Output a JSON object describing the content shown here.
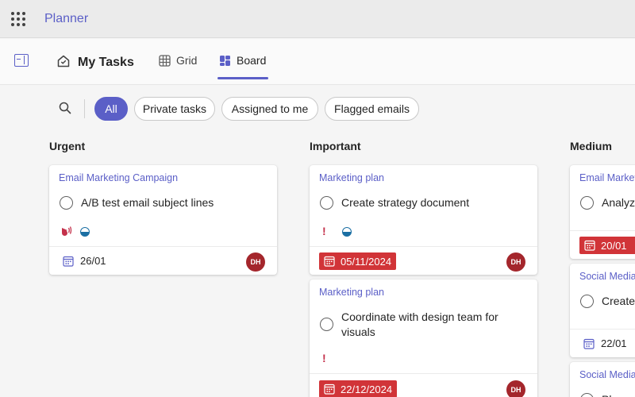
{
  "app": {
    "title": "Planner"
  },
  "header": {
    "title": "My Tasks",
    "tabs": [
      {
        "label": "Grid",
        "active": false
      },
      {
        "label": "Board",
        "active": true
      }
    ]
  },
  "filters": {
    "chips": [
      {
        "label": "All",
        "active": true
      },
      {
        "label": "Private tasks",
        "active": false
      },
      {
        "label": "Assigned to me",
        "active": false
      },
      {
        "label": "Flagged emails",
        "active": false
      }
    ]
  },
  "columns": [
    {
      "title": "Urgent",
      "cards": [
        {
          "plan": "Email Marketing Campaign",
          "task": "A/B test email subject lines",
          "indicators": [
            "urgent-priority-icon",
            "in-progress-icon"
          ],
          "due": "26/01",
          "due_overdue": false,
          "assignee": "DH"
        }
      ]
    },
    {
      "title": "Important",
      "cards": [
        {
          "plan": "Marketing plan",
          "task": "Create strategy document",
          "indicators": [
            "important-priority-icon",
            "in-progress-icon"
          ],
          "due": "05/11/2024",
          "due_overdue": true,
          "assignee": "DH"
        },
        {
          "plan": "Marketing plan",
          "task_line1": "Coordinate with design team for",
          "task_line2": "visuals",
          "indicators": [
            "important-priority-icon"
          ],
          "due": "22/12/2024",
          "due_overdue": true,
          "assignee": "DH"
        }
      ]
    },
    {
      "title": "Medium",
      "cards": [
        {
          "plan": "Email Marketi",
          "task": "Analyze",
          "due": "20/01",
          "due_overdue": true
        },
        {
          "plan": "Social Media",
          "task": "Create",
          "due": "22/01",
          "due_overdue": false
        },
        {
          "plan": "Social Media",
          "task": "Pl"
        }
      ]
    }
  ],
  "colors": {
    "accent": "#5b5fc7",
    "overdue": "#d13438",
    "avatar": "#a4262c",
    "progress": "#1b6fa3"
  }
}
